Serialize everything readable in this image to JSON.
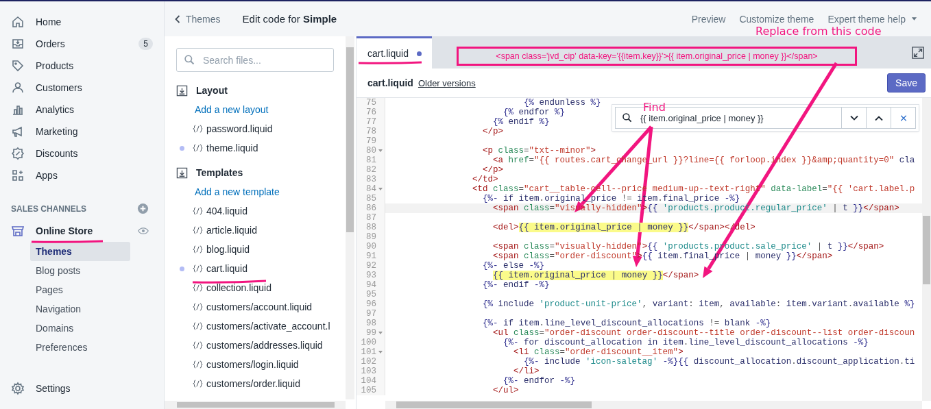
{
  "nav": {
    "items": [
      {
        "label": "Home"
      },
      {
        "label": "Orders",
        "badge": "5"
      },
      {
        "label": "Products"
      },
      {
        "label": "Customers"
      },
      {
        "label": "Analytics"
      },
      {
        "label": "Marketing"
      },
      {
        "label": "Discounts"
      },
      {
        "label": "Apps"
      }
    ],
    "section_title": "SALES CHANNELS",
    "channel": {
      "label": "Online Store",
      "sub_items": [
        {
          "label": "Themes",
          "selected": true
        },
        {
          "label": "Blog posts",
          "selected": false
        },
        {
          "label": "Pages",
          "selected": false
        },
        {
          "label": "Navigation",
          "selected": false
        },
        {
          "label": "Domains",
          "selected": false
        },
        {
          "label": "Preferences",
          "selected": false
        }
      ]
    },
    "settings": "Settings"
  },
  "header": {
    "back": "Themes",
    "title": "Edit code for **Simple**",
    "actions": [
      "Preview",
      "Customize theme",
      "Expert theme help"
    ]
  },
  "files": {
    "search_placeholder": "Search files...",
    "sections": [
      {
        "title": "Layout",
        "add_link": "Add a new layout",
        "files": [
          {
            "name": "password.liquid",
            "modified": false
          },
          {
            "name": "theme.liquid",
            "modified": true
          }
        ]
      },
      {
        "title": "Templates",
        "add_link": "Add a new template",
        "files": [
          {
            "name": "404.liquid",
            "modified": false
          },
          {
            "name": "article.liquid",
            "modified": false
          },
          {
            "name": "blog.liquid",
            "modified": false
          },
          {
            "name": "cart.liquid",
            "modified": true
          },
          {
            "name": "collection.liquid",
            "modified": false
          },
          {
            "name": "customers/account.liquid",
            "modified": false
          },
          {
            "name": "customers/activate_account.l",
            "modified": false
          },
          {
            "name": "customers/addresses.liquid",
            "modified": false
          },
          {
            "name": "customers/login.liquid",
            "modified": false
          },
          {
            "name": "customers/order.liquid",
            "modified": false
          }
        ]
      }
    ]
  },
  "editor": {
    "tab": {
      "label": "cart.liquid",
      "modified": true
    },
    "file": "cart.liquid",
    "older_versions": "Older versions",
    "save": "Save",
    "find": {
      "value": "{{ item.original_price | money }}"
    },
    "lines": [
      {
        "number": "75",
        "fold": false,
        "current": false,
        "parts": [
          {
            "text": "                          {% endunless %}",
            "match": false
          }
        ]
      },
      {
        "number": "76",
        "fold": false,
        "current": false,
        "parts": [
          {
            "text": "                      {% endfor %}",
            "match": false
          }
        ]
      },
      {
        "number": "77",
        "fold": false,
        "current": false,
        "parts": [
          {
            "text": "                    {% endif %}",
            "match": false
          }
        ]
      },
      {
        "number": "78",
        "fold": false,
        "current": false,
        "parts": [
          {
            "text": "                  </p>",
            "match": false
          }
        ]
      },
      {
        "number": "79",
        "fold": false,
        "current": false
      },
      {
        "number": "80",
        "fold": true,
        "current": false,
        "parts": [
          {
            "text": "                  <p class=\"txt--minor\">",
            "match": false
          }
        ]
      },
      {
        "number": "81",
        "fold": false,
        "current": false,
        "parts": [
          {
            "text": "                    <a href=\"{{ routes.cart_change_url }}?line={{ forloop.index }}&amp;quantity=0\" cla",
            "match": false
          }
        ]
      },
      {
        "number": "82",
        "fold": false,
        "current": false,
        "parts": [
          {
            "text": "                  </p>",
            "match": false
          }
        ]
      },
      {
        "number": "83",
        "fold": false,
        "current": false,
        "parts": [
          {
            "text": "                </td>",
            "match": false
          }
        ]
      },
      {
        "number": "84",
        "fold": true,
        "current": false,
        "parts": [
          {
            "text": "                <td class=\"cart__table-cell--price medium-up--text-right\" data-label=\"{{ 'cart.label.p",
            "match": false
          }
        ]
      },
      {
        "number": "85",
        "fold": false,
        "current": false,
        "parts": [
          {
            "text": "                  {%- if item.original_price != item.final_price -%}",
            "match": false
          }
        ]
      },
      {
        "number": "86",
        "fold": false,
        "current": true,
        "parts": [
          {
            "text": "                    <span class=\"visually-hidden\">{{ 'products.product.regular_price' | t }}</span>",
            "match": false
          }
        ]
      },
      {
        "number": "87",
        "fold": false,
        "current": false
      },
      {
        "number": "88",
        "fold": false,
        "current": false,
        "parts": [
          {
            "text": "                    <del>",
            "match": false
          },
          {
            "text": "{{ item.original_price | money }}",
            "match": true
          },
          {
            "text": "</span></del>",
            "match": false
          }
        ]
      },
      {
        "number": "89",
        "fold": false,
        "current": false
      },
      {
        "number": "90",
        "fold": false,
        "current": false,
        "parts": [
          {
            "text": "                    <span class=\"visually-hidden\">{{ 'products.product.sale_price' | t }}</span>",
            "match": false
          }
        ]
      },
      {
        "number": "91",
        "fold": false,
        "current": false,
        "parts": [
          {
            "text": "                    <span class=\"order-discount\">{{ item.final_price | money }}</span>",
            "match": false
          }
        ]
      },
      {
        "number": "92",
        "fold": false,
        "current": false,
        "parts": [
          {
            "text": "                  {%- else -%}",
            "match": false
          }
        ]
      },
      {
        "number": "93",
        "fold": false,
        "current": false,
        "parts": [
          {
            "text": "                    {{ item.original_price | money }}",
            "match": true
          },
          {
            "text": "</span>",
            "match": false
          }
        ]
      },
      {
        "number": "94",
        "fold": false,
        "current": false,
        "parts": [
          {
            "text": "                  {%- endif -%}",
            "match": false
          }
        ]
      },
      {
        "number": "95",
        "fold": false,
        "current": false
      },
      {
        "number": "96",
        "fold": false,
        "current": false,
        "parts": [
          {
            "text": "                  {% include 'product-unit-price', variant: item, available: item.variant.available %}",
            "match": false
          }
        ]
      },
      {
        "number": "97",
        "fold": false,
        "current": false
      },
      {
        "number": "98",
        "fold": false,
        "current": false,
        "parts": [
          {
            "text": "                  {%- if item.line_level_discount_allocations != blank -%}",
            "match": false
          }
        ]
      },
      {
        "number": "99",
        "fold": true,
        "current": false,
        "parts": [
          {
            "text": "                    <ul class=\"order-discount order-discount--title order-discount--list order-discoun",
            "match": false
          }
        ]
      },
      {
        "number": "100",
        "fold": false,
        "current": false,
        "parts": [
          {
            "text": "                      {%- for discount_allocation in item.line_level_discount_allocations -%}",
            "match": false
          }
        ]
      },
      {
        "number": "101",
        "fold": true,
        "current": false,
        "parts": [
          {
            "text": "                        <li class=\"order-discount__item\">",
            "match": false
          }
        ]
      },
      {
        "number": "102",
        "fold": false,
        "current": false,
        "parts": [
          {
            "text": "                          {%- include 'icon-saletag' -%}{{ discount_allocation.discount_application.ti",
            "match": false
          }
        ]
      },
      {
        "number": "103",
        "fold": false,
        "current": false,
        "parts": [
          {
            "text": "                        </li>",
            "match": false
          }
        ]
      },
      {
        "number": "104",
        "fold": false,
        "current": false,
        "parts": [
          {
            "text": "                      {%- endfor -%}",
            "match": false
          }
        ]
      },
      {
        "number": "105",
        "fold": false,
        "current": false,
        "parts": [
          {
            "text": "                    </ul>",
            "match": false
          }
        ]
      }
    ]
  },
  "annotations": {
    "find_label": "Find",
    "replace_label": "Replace from this code",
    "replacement_code": "<span class='jvd_cip' data-key='{{item.key}}'>{{ item.original_price | money }}</span>"
  }
}
